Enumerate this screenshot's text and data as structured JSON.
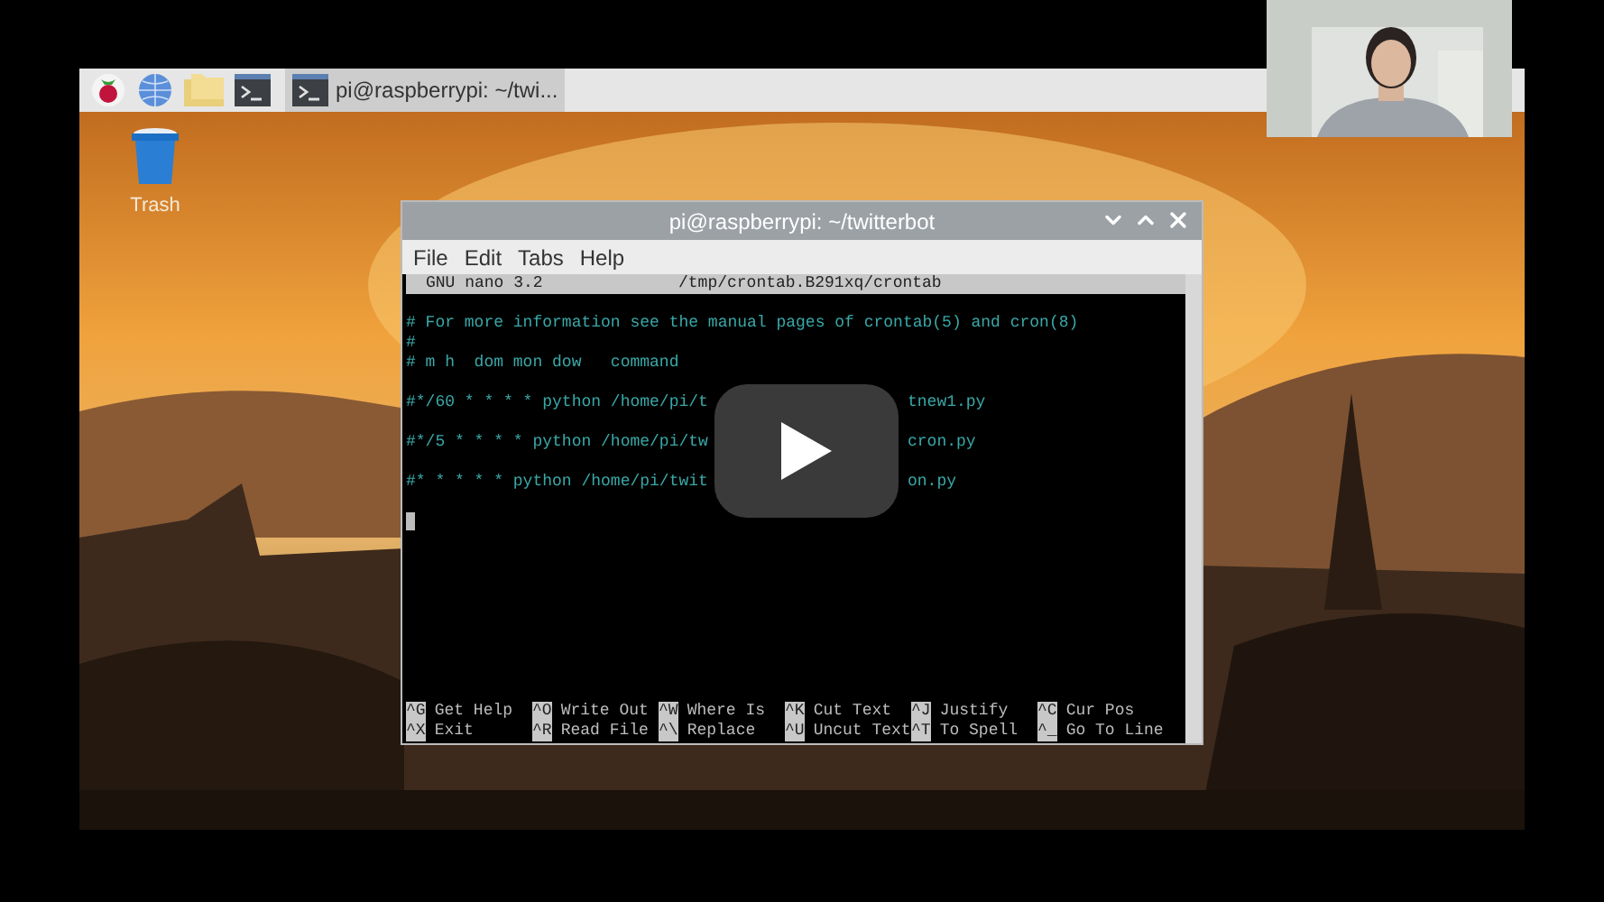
{
  "taskbar": {
    "task": {
      "label": "pi@raspberrypi: ~/twi...",
      "selected": true
    }
  },
  "desktop_icons": [
    {
      "label": "Trash"
    }
  ],
  "terminal": {
    "title": "pi@raspberrypi: ~/twitterbot",
    "menu": [
      "File",
      "Edit",
      "Tabs",
      "Help"
    ],
    "nano": {
      "version": "GNU nano 3.2",
      "file": "/tmp/crontab.B291xq/crontab",
      "blocks": [
        [
          {
            "text": "# For more information see the manual pages of crontab(5) and cron(8)"
          },
          {
            "text": "#"
          },
          {
            "text": "# m h  dom mon dow   command"
          }
        ],
        [
          {
            "text": "#*/60 * * * * python /home/pi/t",
            "tail": "tnew1.py"
          }
        ],
        [
          {
            "text": "#*/5 * * * * python /home/pi/tw",
            "tail": "cron.py"
          }
        ],
        [
          {
            "text": "#* * * * * python /home/pi/twit",
            "tail": "on.py"
          }
        ]
      ],
      "cursor": true,
      "shortcuts": [
        [
          {
            "key": "^G",
            "label": "Get Help"
          },
          {
            "key": "^O",
            "label": "Write Out"
          },
          {
            "key": "^W",
            "label": "Where Is"
          },
          {
            "key": "^K",
            "label": "Cut Text"
          },
          {
            "key": "^J",
            "label": "Justify"
          },
          {
            "key": "^C",
            "label": "Cur Pos"
          }
        ],
        [
          {
            "key": "^X",
            "label": "Exit"
          },
          {
            "key": "^R",
            "label": "Read File"
          },
          {
            "key": "^\\",
            "label": "Replace"
          },
          {
            "key": "^U",
            "label": "Uncut Text"
          },
          {
            "key": "^T",
            "label": "To Spell"
          },
          {
            "key": "^_",
            "label": "Go To Line"
          }
        ]
      ]
    }
  },
  "video": {
    "paused": true
  }
}
